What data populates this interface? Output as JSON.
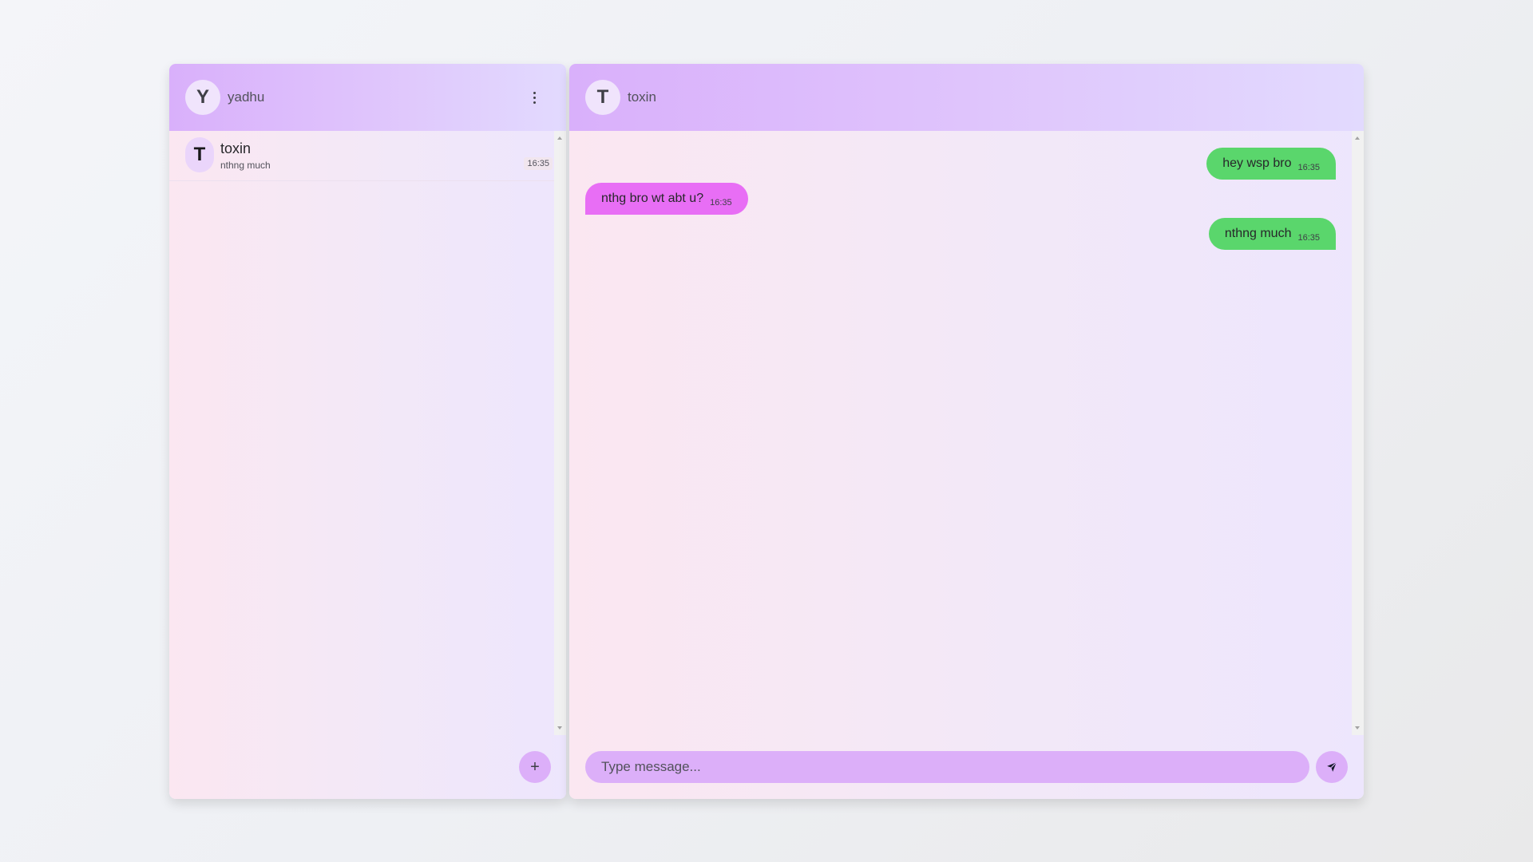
{
  "sidebar": {
    "user": {
      "avatar_letter": "Y",
      "name": "yadhu"
    },
    "menu_icon": "more-vertical-icon",
    "contacts": [
      {
        "avatar_letter": "T",
        "name": "toxin",
        "preview": "nthng much",
        "time": "16:35"
      }
    ],
    "new_chat_label": "+"
  },
  "chat": {
    "contact": {
      "avatar_letter": "T",
      "name": "toxin"
    },
    "messages": [
      {
        "direction": "out",
        "text": "hey wsp bro",
        "time": "16:35"
      },
      {
        "direction": "in",
        "text": "nthg bro wt abt u?",
        "time": "16:35"
      },
      {
        "direction": "out",
        "text": "nthng much",
        "time": "16:35"
      }
    ],
    "composer": {
      "placeholder": "Type message...",
      "value": ""
    },
    "send_icon": "send-icon"
  },
  "colors": {
    "header_gradient_start": "#d9b0fb",
    "outgoing_bubble": "#5ad66c",
    "incoming_bubble": "#e86ef5",
    "accent": "#dcaff9"
  }
}
